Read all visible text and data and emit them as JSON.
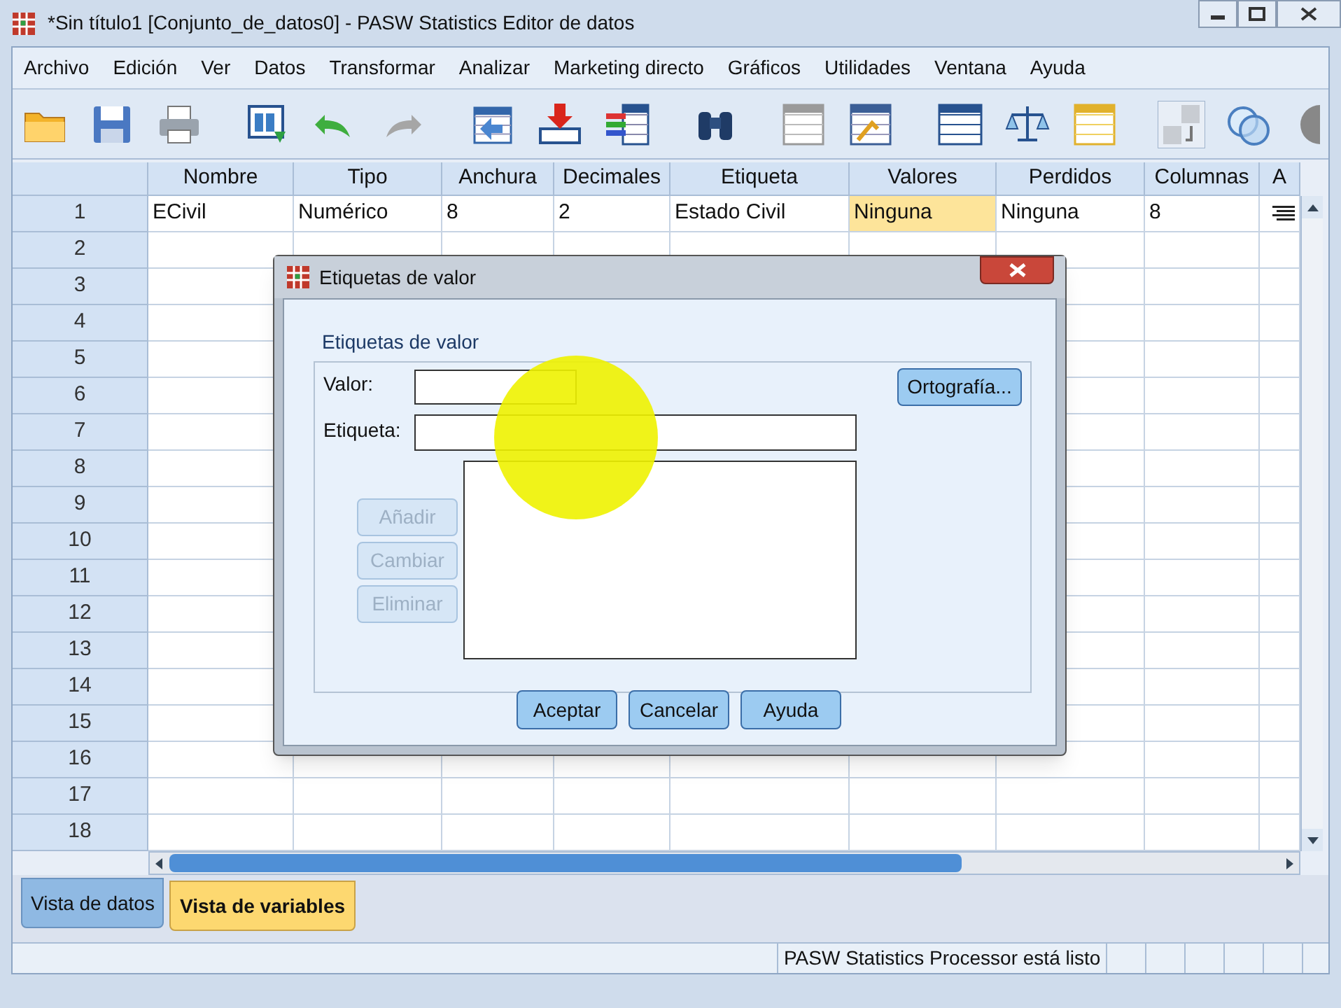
{
  "window": {
    "title": "*Sin título1 [Conjunto_de_datos0] - PASW Statistics Editor de datos"
  },
  "menu": [
    "Archivo",
    "Edición",
    "Ver",
    "Datos",
    "Transformar",
    "Analizar",
    "Marketing directo",
    "Gráficos",
    "Utilidades",
    "Ventana",
    "Ayuda"
  ],
  "table": {
    "columns": [
      "Nombre",
      "Tipo",
      "Anchura",
      "Decimales",
      "Etiqueta",
      "Valores",
      "Perdidos",
      "Columnas",
      "A"
    ],
    "rows": [
      {
        "number": "1",
        "cells": [
          {
            "kind": "text",
            "text": "ECivil",
            "selected": false
          },
          {
            "kind": "text",
            "text": "Numérico",
            "selected": false
          },
          {
            "kind": "text",
            "text": "8",
            "selected": false
          },
          {
            "kind": "text",
            "text": "2",
            "selected": false
          },
          {
            "kind": "text",
            "text": "Estado Civil",
            "selected": false
          },
          {
            "kind": "text",
            "text": "Ninguna",
            "selected": true
          },
          {
            "kind": "text",
            "text": "Ninguna",
            "selected": false
          },
          {
            "kind": "text",
            "text": "8",
            "selected": false
          },
          {
            "kind": "align",
            "selected": false
          }
        ]
      },
      {
        "number": "2"
      },
      {
        "number": "3"
      },
      {
        "number": "4"
      },
      {
        "number": "5"
      },
      {
        "number": "6"
      },
      {
        "number": "7"
      },
      {
        "number": "8"
      },
      {
        "number": "9"
      },
      {
        "number": "10"
      },
      {
        "number": "11"
      },
      {
        "number": "12"
      },
      {
        "number": "13"
      },
      {
        "number": "14"
      },
      {
        "number": "15"
      },
      {
        "number": "16"
      },
      {
        "number": "17"
      },
      {
        "number": "18"
      }
    ]
  },
  "tabs": [
    {
      "label": "Vista de datos",
      "selected": false
    },
    {
      "label": "Vista de variables",
      "selected": true
    }
  ],
  "status_bar": {
    "message": "PASW Statistics Processor está listo"
  },
  "dialog": {
    "title": "Etiquetas de valor",
    "group": "Etiquetas de valor",
    "value_label": "Valor:",
    "label_label": "Etiqueta:",
    "side_buttons": [
      {
        "label": "Añadir",
        "disabled": true
      },
      {
        "label": "Cambiar",
        "disabled": true
      },
      {
        "label": "Eliminar",
        "disabled": true
      }
    ],
    "spelling_button": "Ortografía...",
    "buttons": [
      "Aceptar",
      "Cancelar",
      "Ayuda"
    ]
  }
}
